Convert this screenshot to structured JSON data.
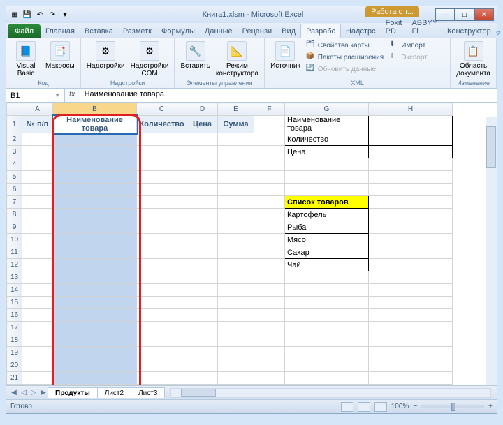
{
  "titlebar": {
    "filename": "Книга1.xlsm",
    "appname": "Microsoft Excel",
    "context_tool": "Работа с т..."
  },
  "tabs": {
    "file": "Файл",
    "items": [
      "Главная",
      "Вставка",
      "Разметк",
      "Формулы",
      "Данные",
      "Рецензи",
      "Вид",
      "Разрабс",
      "Надстрс",
      "Foxit PD",
      "ABBYY Fi",
      "Конструктор"
    ]
  },
  "ribbon": {
    "group_code": {
      "label": "Код",
      "vb": "Visual\nBasic",
      "macros": "Макросы"
    },
    "group_addins": {
      "label": "Надстройки",
      "addins": "Надстройки",
      "com": "Надстройки\nCOM"
    },
    "group_controls": {
      "label": "Элементы управления",
      "insert": "Вставить",
      "design": "Режим\nконструктора"
    },
    "group_xml": {
      "label": "XML",
      "source": "Источник",
      "map_props": "Свойства карты",
      "ext_packs": "Пакеты расширения",
      "refresh": "Обновить данные",
      "import": "Импорт",
      "export": "Экспорт"
    },
    "group_modify": {
      "label": "Изменение",
      "docarea": "Область\nдокумента"
    }
  },
  "formula_bar": {
    "name": "B1",
    "fx": "fx",
    "content": "Наименование товара"
  },
  "columns": [
    "A",
    "B",
    "C",
    "D",
    "E",
    "F",
    "G",
    "H"
  ],
  "headers_row1": {
    "A": "№ п/п",
    "B": "Наименование товара",
    "C": "Количество",
    "D": "Цена",
    "E": "Сумма"
  },
  "right_labels": {
    "r1": "Наименование товара",
    "r2": "Количество",
    "r3": "Цена"
  },
  "goods_list_header": "Список товаров",
  "goods": [
    "Картофель",
    "Рыба",
    "Мясо",
    "Сахар",
    "Чай"
  ],
  "sheets": {
    "active": "Продукты",
    "others": [
      "Лист2",
      "Лист3"
    ]
  },
  "status": {
    "ready": "Готово",
    "zoom": "100%"
  }
}
